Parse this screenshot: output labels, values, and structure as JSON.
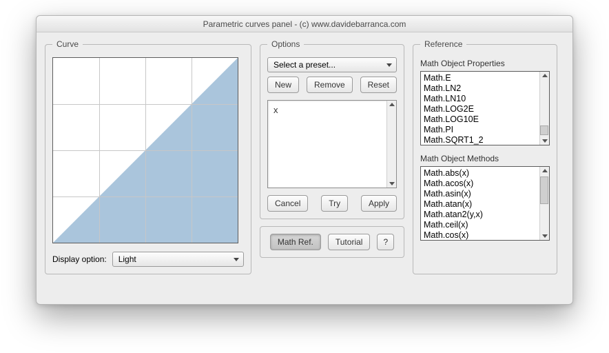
{
  "window": {
    "title": "Parametric curves panel - (c) www.davidebarranca.com"
  },
  "curve": {
    "legend": "Curve",
    "display_label": "Display option:",
    "display_value": "Light"
  },
  "options": {
    "legend": "Options",
    "preset": "Select a preset...",
    "new": "New",
    "remove": "Remove",
    "reset": "Reset",
    "expr": "x",
    "cancel": "Cancel",
    "try": "Try",
    "apply": "Apply"
  },
  "aux": {
    "mathref": "Math Ref.",
    "tutorial": "Tutorial",
    "help": "?"
  },
  "reference": {
    "legend": "Reference",
    "props_label": "Math Object Properties",
    "methods_label": "Math Object Methods",
    "props": [
      "Math.E",
      "Math.LN2",
      "Math.LN10",
      "Math.LOG2E",
      "Math.LOG10E",
      "Math.PI",
      "Math.SQRT1_2"
    ],
    "methods": [
      "Math.abs(x)",
      "Math.acos(x)",
      "Math.asin(x)",
      "Math.atan(x)",
      "Math.atan2(y,x)",
      "Math.ceil(x)",
      "Math.cos(x)"
    ]
  }
}
